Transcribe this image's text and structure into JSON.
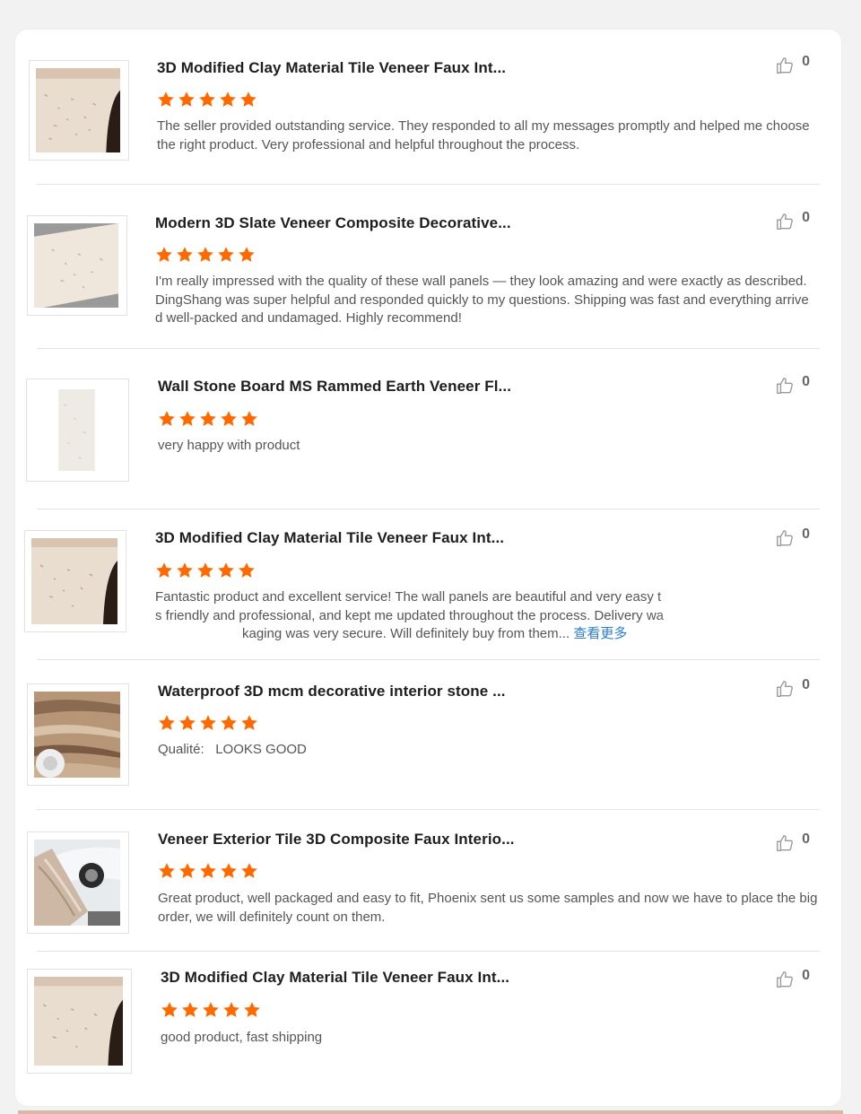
{
  "reviews": [
    {
      "title": "3D Modified Clay Material Tile Veneer Faux Int...",
      "comment": "The seller provided outstanding service. They responded to all my messages promptly and helped me choose the right product. Very professional and helpful throughout the process.",
      "rating": 5,
      "likes": "0",
      "image": "clay-tile-panel"
    },
    {
      "title": "Modern 3D Slate Veneer Composite Decorative...",
      "comment": "I'm really impressed with the quality of these wall panels — they look amazing and were exactly as described. DingShang was super helpful and responded quickly to my questions. Shipping was fast and everything arrived well-packed and undamaged. Highly recommend!",
      "rating": 5,
      "likes": "0",
      "image": "slate-veneer-panel"
    },
    {
      "title": "Wall Stone Board MS Rammed Earth Veneer Fl...",
      "comment": "very happy with product",
      "rating": 5,
      "likes": "0",
      "image": "rammed-earth-board"
    },
    {
      "title": "3D Modified Clay Material Tile Veneer Faux Int...",
      "comment_line1": "Fantastic product and excellent service! The wall panels are beautiful and very easy t",
      "comment_line2": "s friendly and professional, and kept me updated throughout the process. Delivery wa",
      "comment_line3": "kaging was very secure. Will definitely buy from them...",
      "more_label": "查看更多",
      "rating": 5,
      "likes": "0",
      "image": "clay-tile-panel"
    },
    {
      "title": "Waterproof 3D mcm decorative interior stone ...",
      "comment": "Qualité:   LOOKS GOOD",
      "rating": 5,
      "likes": "0",
      "image": "travertine-roll"
    },
    {
      "title": "Veneer Exterior Tile 3D Composite Faux Interio...",
      "comment": "Great product, well packaged and easy to fit, Phoenix sent us some samples and now we have to place the big order, we will definitely count on them.",
      "rating": 5,
      "likes": "0",
      "image": "exterior-tile-car"
    },
    {
      "title": "3D Modified Clay Material Tile Veneer Faux Int...",
      "comment": "good product, fast shipping",
      "rating": 5,
      "likes": "0",
      "image": "clay-tile-panel"
    }
  ],
  "colors": {
    "star": "#ff6a00",
    "link": "#2a7ecf",
    "title": "#1e1e1e",
    "comment": "#555555"
  }
}
